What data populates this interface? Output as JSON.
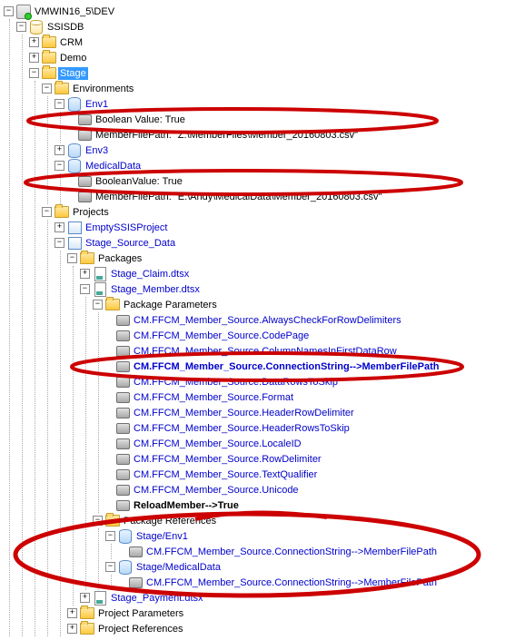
{
  "root": {
    "server_name": "VMWIN16_5\\DEV",
    "catalog": "SSISDB",
    "folders": {
      "crm": "CRM",
      "demo": "Demo",
      "stage": "Stage"
    },
    "environments_label": "Environments",
    "env1": {
      "name": "Env1",
      "bool_label": "Boolean Value:",
      "bool_value": "True",
      "path_label": "MemberFilePath:",
      "path_value": "\"Z:\\MemberFiles\\Member_20160803.csv\""
    },
    "env3": "Env3",
    "medical": {
      "name": "MedicalData",
      "bool_label": "BooleanValue:",
      "bool_value": "True",
      "path_label": "MemberFilePath:",
      "path_value": "\"E:\\Andy\\MedicalData\\Member_20160803.csv\""
    },
    "projects_label": "Projects",
    "empty_proj": "EmptySSISProject",
    "stage_source": "Stage_Source_Data",
    "packages_label": "Packages",
    "pkg_claim": "Stage_Claim.dtsx",
    "pkg_member": "Stage_Member.dtsx",
    "pkg_params_label": "Package Parameters",
    "params": [
      "CM.FFCM_Member_Source.AlwaysCheckForRowDelimiters",
      "CM.FFCM_Member_Source.CodePage",
      "CM.FFCM_Member_Source.ColumnNamesInFirstDataRow",
      "CM.FFCM_Member_Source.ConnectionString-->MemberFilePath",
      "CM.FFCM_Member_Source.DataRowsToSkip",
      "CM.FFCM_Member_Source.Format",
      "CM.FFCM_Member_Source.HeaderRowDelimiter",
      "CM.FFCM_Member_Source.HeaderRowsToSkip",
      "CM.FFCM_Member_Source.LocaleID",
      "CM.FFCM_Member_Source.RowDelimiter",
      "CM.FFCM_Member_Source.TextQualifier",
      "CM.FFCM_Member_Source.Unicode"
    ],
    "reload_member": "ReloadMember-->True",
    "pkg_refs_label": "Package References",
    "ref1": {
      "name": "Stage/Env1",
      "value": "CM.FFCM_Member_Source.ConnectionString-->MemberFilePath"
    },
    "ref2": {
      "name": "Stage/MedicalData",
      "value": "CM.FFCM_Member_Source.ConnectionString-->MemberFilePath"
    },
    "pkg_payment": "Stage_Payment.dtsx",
    "proj_params": "Project Parameters",
    "proj_refs": "Project References"
  }
}
